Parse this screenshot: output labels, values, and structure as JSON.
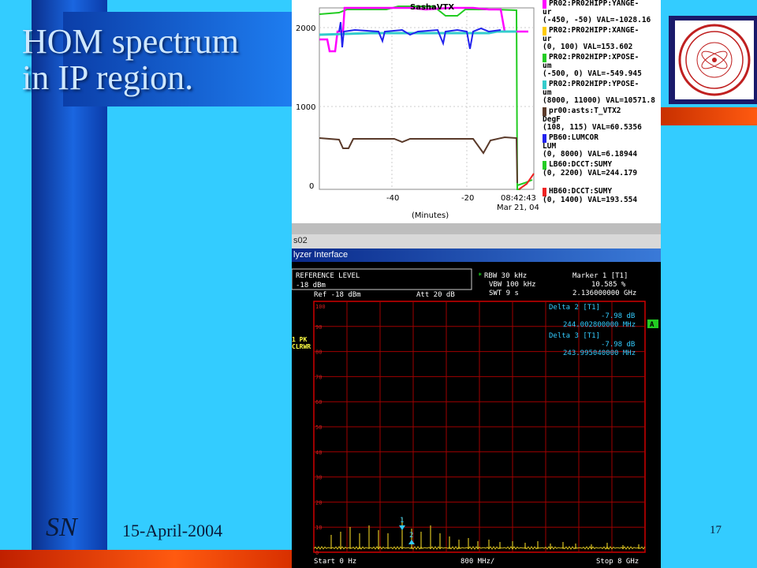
{
  "slide": {
    "title_line1": "HOM spectrum",
    "title_line2": "in IP region.",
    "author": "SN",
    "date": "15-April-2004",
    "page": "17"
  },
  "strip_chart": {
    "title": "SashaVTX",
    "y_ticks": [
      "2000",
      "1000",
      "0"
    ],
    "x_ticks": [
      "-40",
      "-20"
    ],
    "time_label": "08:42:43",
    "date_label": "Mar 21, 04",
    "x_axis_label": "(Minutes)",
    "legend": [
      {
        "name": "PR02:PR02HIPP:YANGE-",
        "unit": "ur",
        "range": "(-450, -50) VAL=-1028.16",
        "color": "#ff00ff"
      },
      {
        "name": "PR02:PR02HIPP:XANGE-",
        "unit": "ur",
        "range": "(0, 100) VAL=153.602",
        "color": "#ffcc00"
      },
      {
        "name": "PR02:PR02HIPP:XPOSE-",
        "unit": "um",
        "range": "(-500, 0) VAL=-549.945",
        "color": "#22cc22"
      },
      {
        "name": "PR02:PR02HIPP:YPOSE-",
        "unit": "um",
        "range": "(8000, 11000) VAL=10571.8",
        "color": "#33cccc"
      },
      {
        "name": "pr00:asts:T_VTX2",
        "unit": "DegF",
        "range": "(108, 115) VAL=60.5356",
        "color": "#5a3a2a"
      },
      {
        "name": "PB60:LUMCOR",
        "unit": "LUM",
        "range": "(0, 8000) VAL=6.18944",
        "color": "#2222ee"
      },
      {
        "name": "LB60:DCCT:SUMY",
        "unit": "",
        "range": "(0, 2200) VAL=244.179",
        "color": "#22cc22"
      },
      {
        "name": "HB60:DCCT:SUMY",
        "unit": "",
        "range": "(0, 1400) VAL=193.554",
        "color": "#ee2222"
      }
    ]
  },
  "window": {
    "strip_text": "s02",
    "title": "lyzer Interface"
  },
  "analyzer": {
    "reference_level_label": "REFERENCE LEVEL",
    "reference_level_value": "-18 dBm",
    "rbw": "RBW 30 kHz",
    "vbw": "VBW 100 kHz",
    "swt": "SWT 9 s",
    "ref": "Ref -18 dBm",
    "att": "Att  20 dB",
    "marker1_label": "Marker 1 [T1]",
    "marker1_value": "10.585 %",
    "marker1_freq": "2.136000000 GHz",
    "delta2_label": "Delta 2 [T1]",
    "delta2_value": "-7.98 dB",
    "delta2_freq": "244.002800000 MHz",
    "delta3_label": "Delta 3 [T1]",
    "delta3_value": "-7.98 dB",
    "delta3_freq": "243.995040000 MHz",
    "side_label1": "1 PK",
    "side_label2": "CLRWR",
    "side_a": "A",
    "start": "Start 0 Hz",
    "span": "800 MHz/",
    "stop": "Stop 8 GHz",
    "marker_tags": [
      "1",
      "2"
    ],
    "grid_labels": [
      "100",
      "90",
      "80",
      "70",
      "60",
      "50",
      "40",
      "30",
      "20",
      "10",
      "0"
    ]
  },
  "colors": {
    "slide_bg": "#33ccff",
    "grid_red": "#b00000",
    "trace": "#d8c020"
  }
}
